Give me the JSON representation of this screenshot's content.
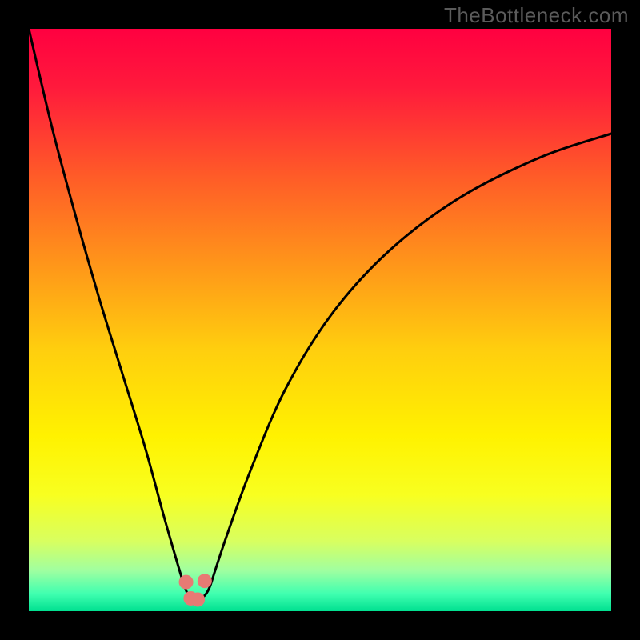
{
  "watermark": "TheBottleneck.com",
  "chart_data": {
    "type": "line",
    "title": "",
    "xlabel": "",
    "ylabel": "",
    "xlim": [
      0,
      100
    ],
    "ylim": [
      0,
      100
    ],
    "grid": false,
    "legend": false,
    "background_gradient": {
      "orientation": "vertical",
      "stops": [
        {
          "pos": 0.0,
          "color": "#ff0040"
        },
        {
          "pos": 0.1,
          "color": "#ff1a3c"
        },
        {
          "pos": 0.25,
          "color": "#ff5a28"
        },
        {
          "pos": 0.4,
          "color": "#ff941a"
        },
        {
          "pos": 0.55,
          "color": "#ffce0e"
        },
        {
          "pos": 0.7,
          "color": "#fff200"
        },
        {
          "pos": 0.8,
          "color": "#f8ff20"
        },
        {
          "pos": 0.88,
          "color": "#d8ff60"
        },
        {
          "pos": 0.93,
          "color": "#a0ffa0"
        },
        {
          "pos": 0.97,
          "color": "#40ffb0"
        },
        {
          "pos": 1.0,
          "color": "#00e090"
        }
      ]
    },
    "series": [
      {
        "name": "bottleneck-curve",
        "color": "#000000",
        "stroke_width": 3,
        "x": [
          0,
          4,
          8,
          12,
          16,
          20,
          23,
          25,
          26.5,
          27.5,
          28.5,
          30,
          31,
          32,
          34,
          38,
          44,
          52,
          62,
          74,
          88,
          100
        ],
        "y": [
          100,
          83,
          68,
          54,
          41,
          28,
          17,
          10,
          5,
          2.5,
          2,
          2.5,
          4,
          7,
          13,
          24,
          38,
          51,
          62,
          71,
          78,
          82
        ]
      }
    ],
    "markers": [
      {
        "name": "min-marker-left",
        "x": 27.0,
        "y": 5.0,
        "r": 9,
        "color": "#e77a74"
      },
      {
        "name": "min-marker-bottomL",
        "x": 27.8,
        "y": 2.2,
        "r": 9,
        "color": "#e77a74"
      },
      {
        "name": "min-marker-bottomR",
        "x": 29.0,
        "y": 2.0,
        "r": 9,
        "color": "#e77a74"
      },
      {
        "name": "min-marker-right",
        "x": 30.2,
        "y": 5.2,
        "r": 9,
        "color": "#e77a74"
      }
    ]
  }
}
